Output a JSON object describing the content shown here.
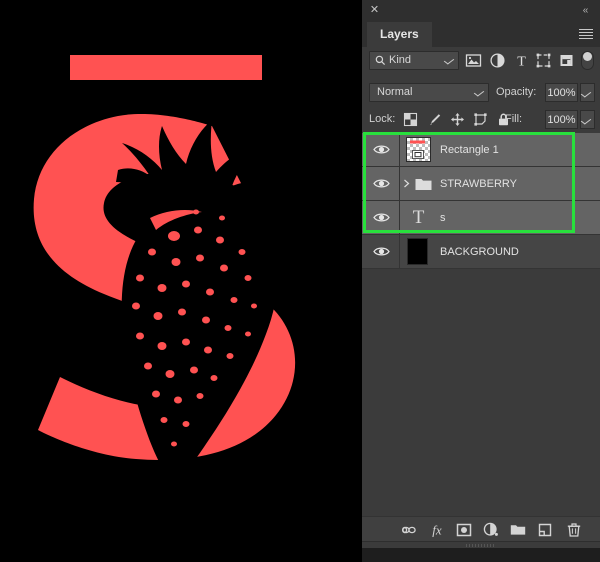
{
  "artwork": {
    "background_color": "#000000",
    "accent_color": "#FF5252",
    "letter": "S",
    "subject": "strawberry"
  },
  "panel": {
    "close_label": "✕",
    "collapse_label": "«",
    "tab_label": "Layers",
    "menu_icon": "hamburger-menu-icon"
  },
  "filter": {
    "kind_label": "Kind",
    "search_icon": "search-icon",
    "icons": [
      {
        "name": "pixel-layer-filter-icon",
        "title": "Pixel layers"
      },
      {
        "name": "adjustment-layer-filter-icon",
        "title": "Adjustment layers"
      },
      {
        "name": "type-layer-filter-icon",
        "title": "Type layers"
      },
      {
        "name": "shape-layer-filter-icon",
        "title": "Shape layers"
      },
      {
        "name": "smart-object-filter-icon",
        "title": "Smart objects"
      }
    ],
    "toggle_name": "filter-enable-toggle"
  },
  "blend": {
    "mode": "Normal",
    "opacity_label": "Opacity:",
    "opacity_value": "100%"
  },
  "lock": {
    "label": "Lock:",
    "icons": [
      {
        "name": "lock-transparent-pixels-icon"
      },
      {
        "name": "lock-image-pixels-icon"
      },
      {
        "name": "lock-position-icon"
      },
      {
        "name": "lock-artboard-nesting-icon"
      },
      {
        "name": "lock-all-icon"
      }
    ],
    "fill_label": "Fill:",
    "fill_value": "100%"
  },
  "layers": [
    {
      "name": "Rectangle 1",
      "kind": "shape",
      "visible": true,
      "selected": true,
      "thumb": "checker-with-red-rect"
    },
    {
      "name": "STRAWBERRY",
      "kind": "group",
      "visible": true,
      "selected": true,
      "expanded": false,
      "thumb": "folder"
    },
    {
      "name": "s",
      "kind": "type",
      "visible": true,
      "selected": true,
      "thumb": "type-T"
    },
    {
      "name": "BACKGROUND",
      "kind": "pixel",
      "visible": true,
      "selected": false,
      "thumb": "solid-black"
    }
  ],
  "selection_highlight": {
    "color": "#28e03c",
    "covers": [
      "Rectangle 1",
      "STRAWBERRY",
      "s"
    ]
  },
  "bottom_toolbar": [
    {
      "name": "link-layers-icon",
      "title": "Link layers"
    },
    {
      "name": "layer-style-fx-icon",
      "title": "Add a layer style"
    },
    {
      "name": "add-layer-mask-icon",
      "title": "Add layer mask"
    },
    {
      "name": "new-adjustment-layer-icon",
      "title": "Create new fill or adjustment layer"
    },
    {
      "name": "new-group-icon",
      "title": "Create a new group"
    },
    {
      "name": "new-layer-icon",
      "title": "Create a new layer"
    },
    {
      "name": "delete-layer-icon",
      "title": "Delete layer"
    }
  ]
}
